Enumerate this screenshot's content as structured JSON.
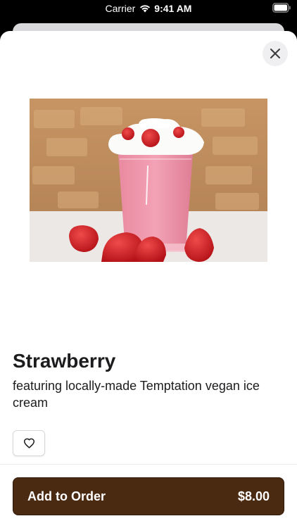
{
  "status_bar": {
    "carrier": "Carrier",
    "time": "9:41 AM",
    "wifi_icon": "wifi-icon",
    "battery_icon": "battery-icon"
  },
  "modal": {
    "close_icon": "close-icon",
    "image_description": "strawberry-smoothie",
    "product_name": "Strawberry",
    "description": "featuring locally-made Temptation vegan ice cream",
    "favorite_icon": "heart-icon",
    "add_to_order_label": "Add to Order",
    "price": "$8.00"
  },
  "colors": {
    "primary_button": "#4b2a12",
    "text": "#1c1c1e",
    "background": "#ffffff"
  }
}
